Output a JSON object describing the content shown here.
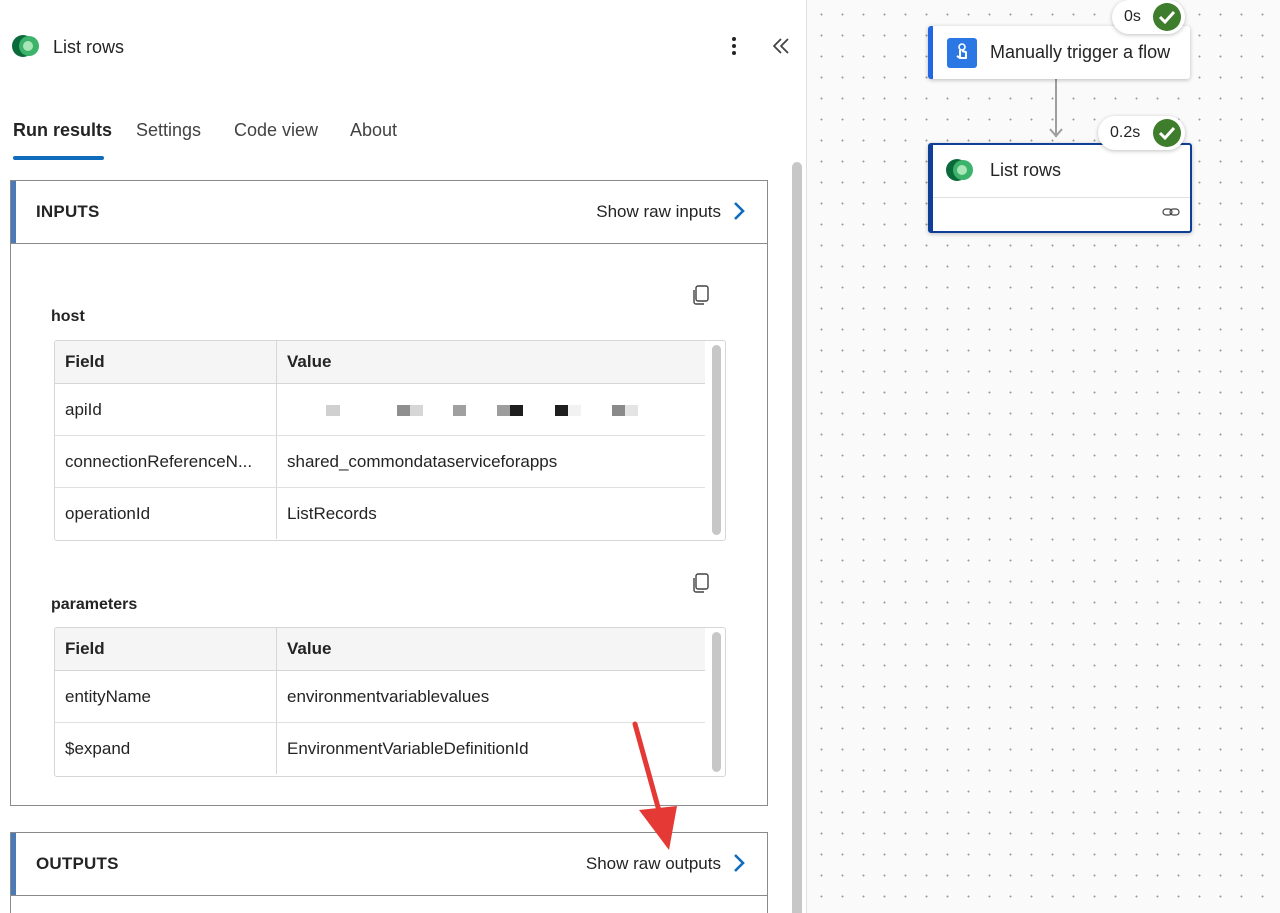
{
  "panel": {
    "title": "List rows",
    "tabs": [
      {
        "label": "Run results",
        "active": true
      },
      {
        "label": "Settings",
        "active": false
      },
      {
        "label": "Code view",
        "active": false
      },
      {
        "label": "About",
        "active": false
      }
    ]
  },
  "inputs": {
    "label": "INPUTS",
    "raw_link": "Show raw inputs",
    "host": {
      "label": "host",
      "headers": [
        "Field",
        "Value"
      ],
      "rows": [
        {
          "field": "apiId",
          "value": "",
          "redacted": true
        },
        {
          "field": "connectionReferenceN...",
          "value": "shared_commondataserviceforapps"
        },
        {
          "field": "operationId",
          "value": "ListRecords"
        }
      ]
    },
    "parameters": {
      "label": "parameters",
      "headers": [
        "Field",
        "Value"
      ],
      "rows": [
        {
          "field": "entityName",
          "value": "environmentvariablevalues"
        },
        {
          "field": "$expand",
          "value": "EnvironmentVariableDefinitionId"
        }
      ]
    }
  },
  "outputs": {
    "label": "OUTPUTS",
    "raw_link": "Show raw outputs"
  },
  "canvas": {
    "trigger": {
      "title": "Manually trigger a flow",
      "duration": "0s",
      "status": "succeeded"
    },
    "action": {
      "title": "List rows",
      "duration": "0.2s",
      "status": "succeeded"
    }
  },
  "colors": {
    "accent": "#0f6cbd",
    "success": "#3d7d2c",
    "section_bar": "#4a7bb7",
    "annotation_arrow": "#e53935"
  }
}
